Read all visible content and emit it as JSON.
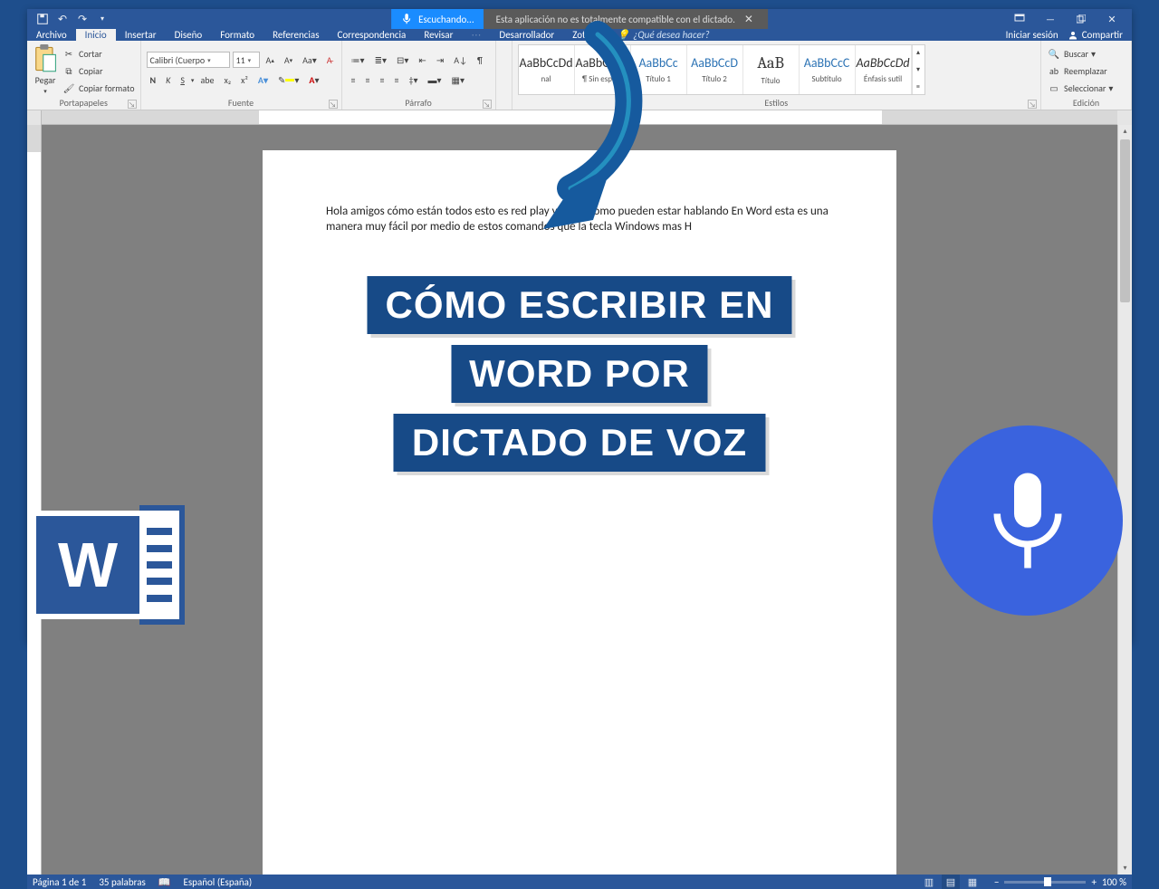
{
  "titlebar": {
    "listening_label": "Escuchando...",
    "compat_text": "Esta aplicación no es totalmente compatible con el dictado."
  },
  "tabs": {
    "archivo": "Archivo",
    "inicio": "Inicio",
    "insertar": "Insertar",
    "diseno": "Diseño",
    "formato": "Formato",
    "referencias": "Referencias",
    "correspondencia": "Correspondencia",
    "revisar": "Revisar",
    "desarrollador": "Desarrollador",
    "zotero": "Zotero",
    "tell_me": "¿Qué desea hacer?",
    "iniciar_sesion": "Iniciar sesión",
    "compartir": "Compartir"
  },
  "ribbon": {
    "portapapeles": {
      "label": "Portapapeles",
      "pegar": "Pegar",
      "cortar": "Cortar",
      "copiar": "Copiar",
      "copiar_formato": "Copiar formato"
    },
    "fuente": {
      "label": "Fuente",
      "font_name": "Calibri (Cuerpo",
      "font_size": "11",
      "bold": "N",
      "italic": "K",
      "underline": "S"
    },
    "parrafo": {
      "label": "Párrafo"
    },
    "estilos": {
      "label": "Estilos",
      "items": [
        {
          "preview": "AaBbCcDd",
          "name": "nal",
          "cls": ""
        },
        {
          "preview": "AaBbCcDd",
          "name": "¶ Sin espa...",
          "cls": ""
        },
        {
          "preview": "AaBbCc",
          "name": "Título 1",
          "cls": "blue"
        },
        {
          "preview": "AaBbCcD",
          "name": "Título 2",
          "cls": "blue"
        },
        {
          "preview": "AaB",
          "name": "Título",
          "cls": "big"
        },
        {
          "preview": "AaBbCcC",
          "name": "Subtítulo",
          "cls": "blue"
        },
        {
          "preview": "AaBbCcDd",
          "name": "Énfasis sutil",
          "cls": "ital"
        }
      ]
    },
    "edicion": {
      "label": "Edición",
      "buscar": "Buscar",
      "reemplazar": "Reemplazar",
      "seleccionar": "Seleccionar"
    }
  },
  "document": {
    "text": "Hola amigos cómo están todos esto es red play y así es como pueden estar hablando En Word esta es una manera muy fácil por medio de estos comandos que la tecla Windows mas H"
  },
  "statusbar": {
    "page": "Página 1 de 1",
    "words": "35 palabras",
    "lang": "Español (España)",
    "zoom": "100 %"
  },
  "overlay": {
    "l1": "CÓMO ESCRIBIR EN",
    "l2": "WORD POR",
    "l3": "DICTADO DE VOZ",
    "word_w": "W"
  }
}
